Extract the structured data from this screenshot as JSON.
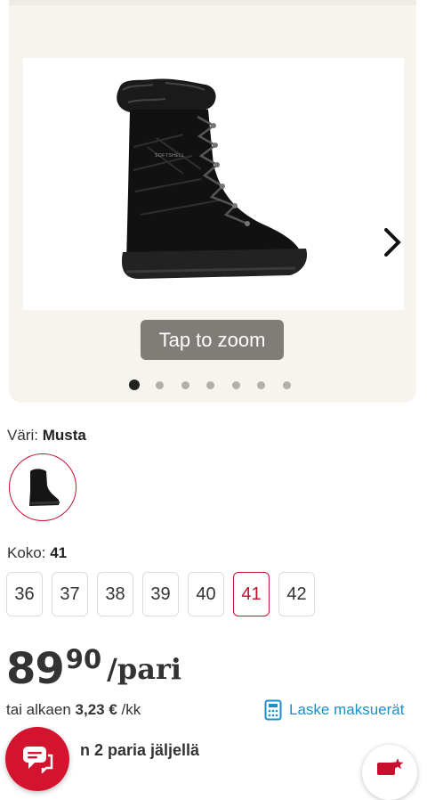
{
  "gallery": {
    "image_alt": "boot-product-image",
    "boot_brand_text": "SOFTSHELL",
    "zoom_hint": "Tap to zoom",
    "dot_count": 7,
    "active_dot": 0
  },
  "color": {
    "label": "Väri:",
    "value": "Musta"
  },
  "size": {
    "label": "Koko:",
    "value": "41",
    "options": [
      "36",
      "37",
      "38",
      "39",
      "40",
      "41",
      "42"
    ],
    "selected": "41"
  },
  "price": {
    "integer": "89",
    "decimals": "90",
    "unit": "/pari"
  },
  "installment": {
    "prefix": "tai alkaen",
    "amount": "3,23 €",
    "suffix": "/kk",
    "link_label": "Laske maksuerät"
  },
  "stock": {
    "text": "n 2 paria jäljellä"
  },
  "colors": {
    "accent": "#c8102e",
    "link": "#1b8fc9",
    "gallery_bg": "#f7f4ef",
    "stock_green": "#2e9b52"
  }
}
